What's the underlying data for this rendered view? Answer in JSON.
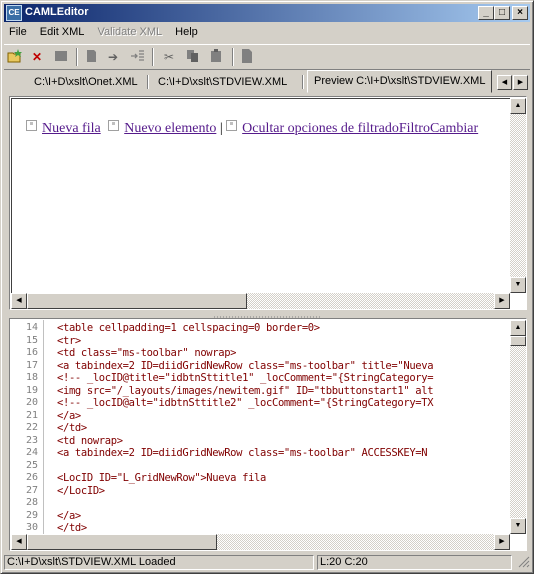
{
  "app": {
    "title": "CAMLEditor",
    "icon_text": "CE"
  },
  "window_controls": {
    "minimize": "_",
    "maximize": "□",
    "close": "×"
  },
  "menu": [
    "File",
    "Edit XML",
    "Validate XML",
    "Help"
  ],
  "toolbar_icons": [
    "open-icon",
    "delete-icon",
    "stop-icon",
    "save-icon",
    "arrow-right-icon",
    "insert-icon",
    "cut-icon",
    "copy-icon",
    "paste-icon",
    "document-icon"
  ],
  "tabs": [
    {
      "label": "C:\\I+D\\xslt\\Onet.XML"
    },
    {
      "label": "C:\\I+D\\xslt\\STDVIEW.XML"
    },
    {
      "label": "Preview C:\\I+D\\xslt\\STDVIEW.XML"
    }
  ],
  "preview": {
    "links": [
      {
        "text": "Nueva fila"
      },
      {
        "text": "Nuevo elemento"
      },
      {
        "text": "Ocultar opciones de filtradoFiltroCambiar"
      }
    ],
    "separator": "|"
  },
  "editor": {
    "lines": [
      {
        "n": "14",
        "text": "<table cellpadding=1 cellspacing=0 border=0>"
      },
      {
        "n": "15",
        "text": "<tr>"
      },
      {
        "n": "16",
        "text": "<td class=\"ms-toolbar\" nowrap>"
      },
      {
        "n": "17",
        "text": "<a tabindex=2 ID=diidGridNewRow class=\"ms-toolbar\" title=\"Nueva"
      },
      {
        "n": "18",
        "text": "<!-- _locID@title=\"idbtnSttitle1\" _locComment=\"{StringCategory="
      },
      {
        "n": "19",
        "text": "<img src=\"/_layouts/images/newitem.gif\" ID=\"tbbuttonstart1\" alt"
      },
      {
        "n": "20",
        "text": "<!-- _locID@alt=\"idbtnSttitle2\" _locComment=\"{StringCategory=TX"
      },
      {
        "n": "21",
        "text": "</a>"
      },
      {
        "n": "22",
        "text": "</td>"
      },
      {
        "n": "23",
        "text": "<td nowrap>"
      },
      {
        "n": "24",
        "text": "<a tabindex=2 ID=diidGridNewRow class=\"ms-toolbar\" ACCESSKEY=N"
      },
      {
        "n": "25",
        "text": ""
      },
      {
        "n": "26",
        "text": "<LocID ID=\"L_GridNewRow\">Nueva fila"
      },
      {
        "n": "27",
        "text": "</LocID>"
      },
      {
        "n": "28",
        "text": ""
      },
      {
        "n": "29",
        "text": "</a>"
      },
      {
        "n": "30",
        "text": "</td>"
      }
    ]
  },
  "status": {
    "message": "C:\\I+D\\xslt\\STDVIEW.XML Loaded",
    "position": "L:20 C:20"
  },
  "colors": {
    "title_start": "#0a246a",
    "title_end": "#a6caf0",
    "link": "#551a8b",
    "code": "#800000",
    "face": "#d4d0c8"
  }
}
